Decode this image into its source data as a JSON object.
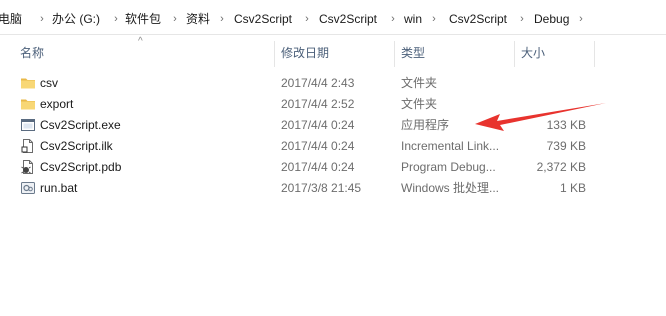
{
  "breadcrumb": {
    "items": [
      "电脑",
      "办公 (G:)",
      "软件包",
      "资料",
      "Csv2Script",
      "Csv2Script",
      "win",
      "Csv2Script",
      "Debug"
    ],
    "separator": "›"
  },
  "columns": {
    "name": "名称",
    "date": "修改日期",
    "type": "类型",
    "size": "大小",
    "sort_indicator": "^"
  },
  "files": [
    {
      "name": "csv",
      "date": "2017/4/4 2:43",
      "type": "文件夹",
      "size": "",
      "icon": "folder-icon"
    },
    {
      "name": "export",
      "date": "2017/4/4 2:52",
      "type": "文件夹",
      "size": "",
      "icon": "folder-icon"
    },
    {
      "name": "Csv2Script.exe",
      "date": "2017/4/4 0:24",
      "type": "应用程序",
      "size": "133 KB",
      "icon": "application-icon"
    },
    {
      "name": "Csv2Script.ilk",
      "date": "2017/4/4 0:24",
      "type": "Incremental Link...",
      "size": "739 KB",
      "icon": "document-icon"
    },
    {
      "name": "Csv2Script.pdb",
      "date": "2017/4/4 0:24",
      "type": "Program Debug...",
      "size": "2,372 KB",
      "icon": "debug-file-icon"
    },
    {
      "name": "run.bat",
      "date": "2017/3/8 21:45",
      "type": "Windows 批处理...",
      "size": "1 KB",
      "icon": "batch-file-icon"
    }
  ],
  "colors": {
    "folder": "#f8d775",
    "header_text": "#4c607a",
    "annotation_arrow": "#e8332e"
  }
}
